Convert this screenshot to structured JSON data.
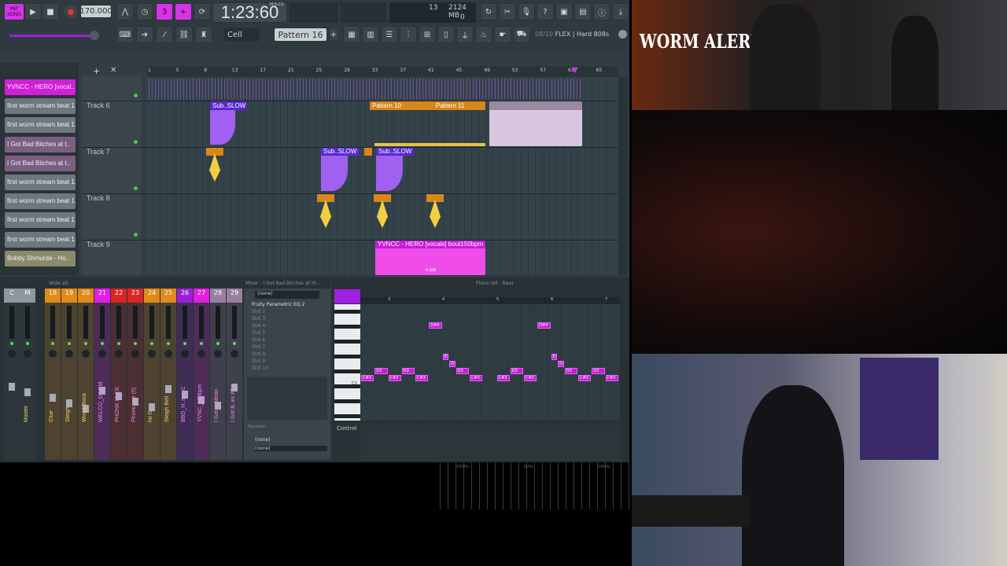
{
  "toolbar": {
    "mode": "SONG",
    "pat": "PAT",
    "tempo": "170.000",
    "time": "1:23:60",
    "time_unit": "M:S:CS",
    "cpu": "13",
    "memory": "2124 MB",
    "poly": "0",
    "snap": "Cell",
    "pattern": "Pattern 16",
    "news": "08/10",
    "news_text": "FLEX | Hard 808s"
  },
  "browser": {
    "items": [
      {
        "label": "YVNCC - HERO [vocal..",
        "color": "#d21fd8"
      },
      {
        "label": "first worm stream beat 1..",
        "color": "#6f777c"
      },
      {
        "label": "first worm stream beat 1..",
        "color": "#6f777c"
      },
      {
        "label": "I Got Bad Bitches at t..",
        "color": "#7b5f80"
      },
      {
        "label": "I Got Bad Bitches at t..",
        "color": "#7b5f80"
      },
      {
        "label": "first worm stream beat 1..",
        "color": "#6f777c"
      },
      {
        "label": "first worm stream beat 1..",
        "color": "#6f777c"
      },
      {
        "label": "first worm stream beat 1..",
        "color": "#6f777c"
      },
      {
        "label": "first worm stream beat 1..",
        "color": "#6f777c"
      },
      {
        "label": "Bobby Shmurda - Ho..",
        "color": "#8a8a6a"
      }
    ]
  },
  "playlist": {
    "ruler": [
      "1",
      "5",
      "9",
      "13",
      "17",
      "21",
      "25",
      "29",
      "33",
      "37",
      "41",
      "45",
      "49",
      "53",
      "57",
      "61",
      "65"
    ],
    "tracks": [
      "Track 6",
      "Track 7",
      "Track 8",
      "Track 9"
    ],
    "clips": {
      "sub1": "Sub..SLOW",
      "sub2": "Sub..SLOW",
      "sub3": "Sub..SLOW",
      "p10": "Pattern 10",
      "p11": "Pattern 11",
      "vocal": "YVNCC - HERO [vocals] bout150bpm",
      "vol": "-6.3dB"
    }
  },
  "mixer": {
    "title": "Mixer - I Got Bad Bitches at th..",
    "preset": "Wide alt",
    "strips": [
      {
        "num": "C",
        "name": "",
        "color": "#8e979b"
      },
      {
        "num": "M",
        "name": "Master",
        "color": "#8e979b"
      },
      {
        "num": "18",
        "name": "Glue",
        "color": "#e08a1a"
      },
      {
        "num": "19",
        "name": "Sleigh",
        "color": "#e08a1a"
      },
      {
        "num": "20",
        "name": "Wood Block",
        "color": "#e08a1a"
      },
      {
        "num": "21",
        "name": "WELCO_DOOM",
        "color": "#e21fe0"
      },
      {
        "num": "22",
        "name": "PHONK KLCK",
        "color": "#d82626"
      },
      {
        "num": "23",
        "name": "Phonk..ure (5)",
        "color": "#d82626"
      },
      {
        "num": "24",
        "name": "hit G",
        "color": "#e08a1a"
      },
      {
        "num": "25",
        "name": "Sleigh Bell",
        "color": "#e08a1a"
      },
      {
        "num": "26",
        "name": "BBD_H..ain_C",
        "color": "#9a1fd8"
      },
      {
        "num": "27",
        "name": "YVNC_150bpm",
        "color": "#e21fe0"
      },
      {
        "num": "28",
        "name": "I Got..a Mean",
        "color": "#9b7fa0"
      },
      {
        "num": "29",
        "name": "I Got B..es #2",
        "color": "#9b7fa0"
      }
    ],
    "insert": {
      "input": "(none)",
      "slots": [
        "Fruity Parametric EQ 2",
        "Slot 2",
        "Slot 3",
        "Slot 4",
        "Slot 5",
        "Slot 6",
        "Slot 7",
        "Slot 8",
        "Slot 9",
        "Slot 10"
      ],
      "eq_label": "Equalizer",
      "output1": "(none)",
      "output2": "(none)"
    }
  },
  "pianoroll": {
    "title": "Piano roll - Bass",
    "bars": [
      "3",
      "4",
      "5",
      "6",
      "7"
    ],
    "key_label": "C3",
    "control": "Control",
    "notes": [
      {
        "p": "C#3",
        "b": 0,
        "l": 1
      },
      {
        "p": "D3",
        "b": 1,
        "l": 1
      },
      {
        "p": "C#3",
        "b": 2,
        "l": 1
      },
      {
        "p": "D3",
        "b": 3,
        "l": 1
      },
      {
        "p": "C#3",
        "b": 4,
        "l": 1
      },
      {
        "p": "D#4",
        "b": 5,
        "l": 1
      },
      {
        "p": "E3",
        "b": 6,
        "l": 0.5
      },
      {
        "p": "D#3",
        "b": 6.5,
        "l": 0.5
      },
      {
        "p": "D3",
        "b": 7,
        "l": 1
      },
      {
        "p": "C#3",
        "b": 8,
        "l": 1
      },
      {
        "p": "C#3",
        "b": 10,
        "l": 1
      },
      {
        "p": "D3",
        "b": 11,
        "l": 1
      },
      {
        "p": "C#3",
        "b": 12,
        "l": 1
      },
      {
        "p": "D#4",
        "b": 13,
        "l": 1
      },
      {
        "p": "E3",
        "b": 14,
        "l": 0.5
      },
      {
        "p": "D#3",
        "b": 14.5,
        "l": 0.5
      },
      {
        "p": "D3",
        "b": 15,
        "l": 1
      },
      {
        "p": "C#3",
        "b": 16,
        "l": 1
      },
      {
        "p": "D3",
        "b": 17,
        "l": 1
      },
      {
        "p": "C#3",
        "b": 18,
        "l": 1
      }
    ]
  },
  "spectrum": {
    "labels": [
      "100Hz",
      "1kHz",
      "10kHz"
    ]
  },
  "overlay": {
    "alert": "WORM ALERT"
  },
  "colors": {
    "accent": "#d633e8",
    "bg": "#2f3a40",
    "orange": "#e08a1a"
  }
}
